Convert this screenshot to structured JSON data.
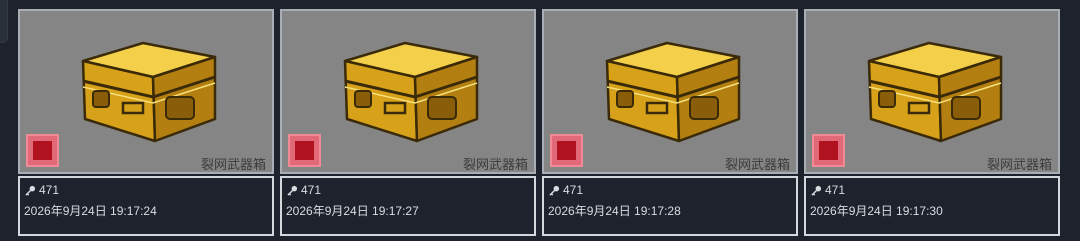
{
  "cards": [
    {
      "item_name": "裂网武器箱",
      "key_count": "471",
      "timestamp": "2026年9月24日 19:17:24",
      "icon": "weapon-case-icon",
      "badge_icon": "receipt-icon"
    },
    {
      "item_name": "裂网武器箱",
      "key_count": "471",
      "timestamp": "2026年9月24日 19:17:27",
      "icon": "weapon-case-icon",
      "badge_icon": "receipt-icon"
    },
    {
      "item_name": "裂网武器箱",
      "key_count": "471",
      "timestamp": "2026年9月24日 19:17:28",
      "icon": "weapon-case-icon",
      "badge_icon": "receipt-icon"
    },
    {
      "item_name": "裂网武器箱",
      "key_count": "471",
      "timestamp": "2026年9月24日 19:17:30",
      "icon": "weapon-case-icon",
      "badge_icon": "receipt-icon"
    }
  ],
  "colors": {
    "background": "#1d222c",
    "thumb_bg": "#858585",
    "case_gold": "#e6b422",
    "badge": "#e26a78",
    "text": "#d9dce1"
  }
}
